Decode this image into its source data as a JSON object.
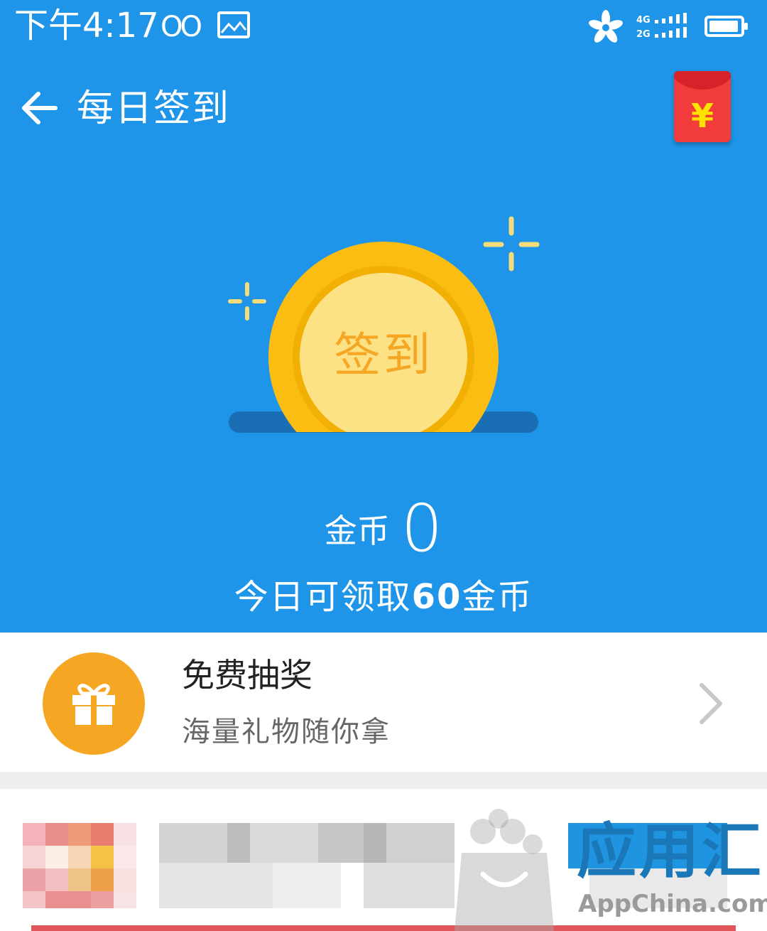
{
  "status_bar": {
    "time": "下午4:17",
    "network_top": "4G",
    "network_bottom": "2G"
  },
  "header": {
    "title": "每日签到",
    "red_packet_symbol": "¥"
  },
  "checkin": {
    "button_label": "签到",
    "coins_label": "金币",
    "coins_value": "0",
    "today_prefix": "今日可领取",
    "today_amount": "60",
    "today_suffix": "金币"
  },
  "lottery": {
    "title": "免费抽奖",
    "subtitle": "海量礼物随你拿"
  },
  "watermark": {
    "text": "应用汇",
    "url": "AppChina.com"
  },
  "colors": {
    "primary_blue": "#1e95e8",
    "coin_gold": "#fcbd13",
    "accent_orange": "#f5a623",
    "red_packet": "#f23b3b"
  }
}
